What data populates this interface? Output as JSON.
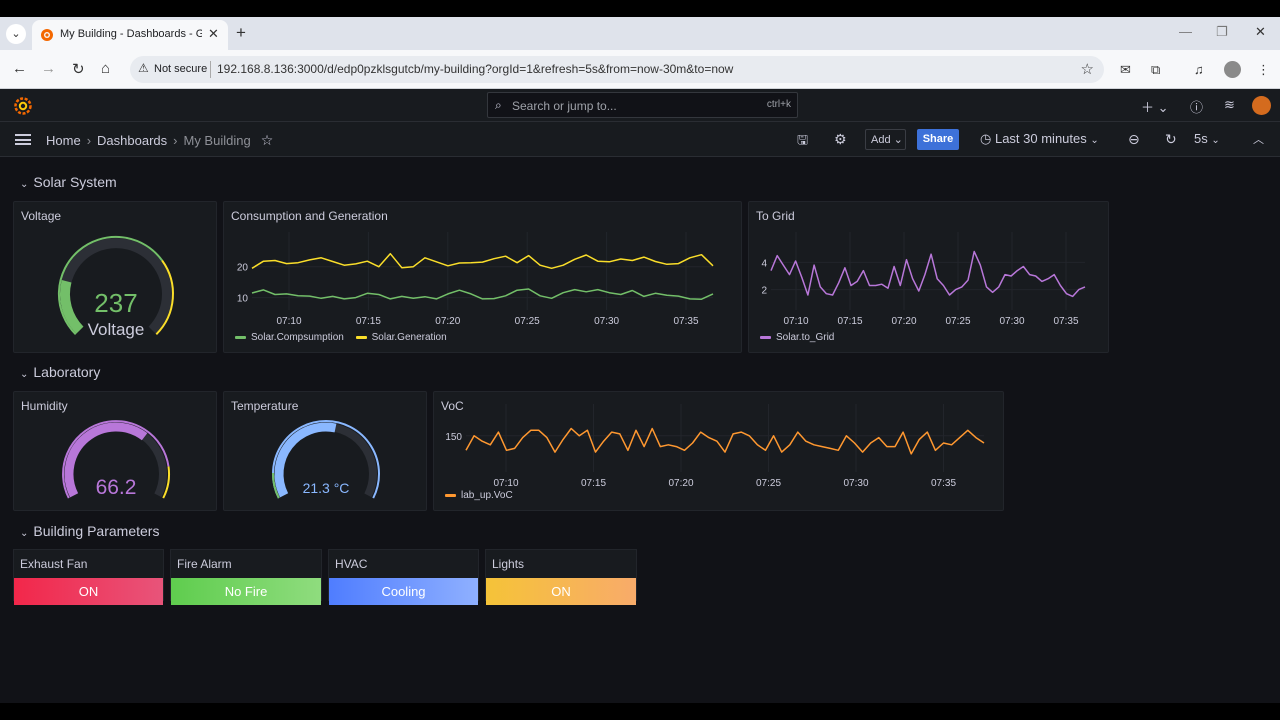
{
  "browser": {
    "tab_title": "My Building - Dashboards - Gr",
    "security_label": "Not secure",
    "url": "192.168.8.136:3000/d/edp0pzklsgutcb/my-building?orgId=1&refresh=5s&from=now-30m&to=now"
  },
  "grafana": {
    "search_placeholder": "Search or jump to...",
    "search_shortcut": "ctrl+k",
    "breadcrumb": [
      "Home",
      "Dashboards",
      "My Building"
    ],
    "toolbar": {
      "add_label": "Add",
      "share_label": "Share",
      "time_range": "Last 30 minutes",
      "refresh_interval": "5s"
    }
  },
  "rows": {
    "solar": "Solar System",
    "lab": "Laboratory",
    "building": "Building Parameters"
  },
  "panels": {
    "voltage": {
      "title": "Voltage",
      "value": "237",
      "unit_label": "Voltage",
      "fraction": 0.7,
      "color": "#73bf69"
    },
    "consumption": {
      "title": "Consumption and Generation"
    },
    "to_grid": {
      "title": "To Grid"
    },
    "humidity": {
      "title": "Humidity",
      "value": "66.2",
      "fraction": 0.66,
      "color": "#b877d9"
    },
    "temperature": {
      "title": "Temperature",
      "value": "21.3 °C",
      "fraction": 0.55,
      "color": "#8ab8ff"
    },
    "voc": {
      "title": "VoC"
    }
  },
  "chart_data": [
    {
      "type": "line",
      "panel": "Consumption and Generation",
      "x_ticks": [
        "07:10",
        "07:15",
        "07:20",
        "07:25",
        "07:30",
        "07:35"
      ],
      "y_ticks": [
        10,
        20
      ],
      "ylim": [
        6,
        28
      ],
      "series": [
        {
          "name": "Solar.Compsumption",
          "color": "#73bf69",
          "values": [
            11.5,
            12.5,
            11,
            11.2,
            10.6,
            10.5,
            9.8,
            10.4,
            9.6,
            10,
            11.4,
            11,
            9.6,
            10.4,
            9.8,
            10.3,
            9.6,
            11.2,
            12.4,
            11.2,
            9.6,
            9.7,
            10.6,
            12.4,
            12.8,
            10.6,
            9.8,
            11.6,
            12.6,
            11.9,
            12.6,
            11.6,
            11,
            12.3,
            10.4,
            11.4,
            10.8,
            10.5,
            9.6,
            9.5,
            11.2
          ]
        },
        {
          "name": "Solar.Generation",
          "color": "#fade2a",
          "values": [
            19.5,
            21.8,
            22,
            21,
            21.3,
            22.2,
            22.9,
            21.7,
            20.5,
            20.9,
            21.8,
            20,
            24.2,
            19.7,
            20,
            22.9,
            21.6,
            20.3,
            21.2,
            21.3,
            21.5,
            22.6,
            23.4,
            21.3,
            23.6,
            20.5,
            19.5,
            20.5,
            22.4,
            23.8,
            21.8,
            21.6,
            22.5,
            22,
            23.1,
            21.7,
            20.8,
            21,
            22.9,
            23.9,
            20.3
          ]
        }
      ]
    },
    {
      "type": "line",
      "panel": "To Grid",
      "x_ticks": [
        "07:10",
        "07:15",
        "07:20",
        "07:25",
        "07:30",
        "07:35"
      ],
      "y_ticks": [
        2,
        4
      ],
      "ylim": [
        0.5,
        5.5
      ],
      "series": [
        {
          "name": "Solar.to_Grid",
          "color": "#b877d9",
          "values": [
            3.4,
            4.5,
            3.8,
            3.1,
            4.1,
            2.9,
            1.6,
            3.8,
            2.2,
            1.7,
            1.6,
            2.5,
            3.6,
            2.3,
            2.6,
            3.4,
            2.3,
            2.3,
            2.4,
            2.1,
            3.7,
            2.3,
            4.2,
            2.8,
            1.9,
            3.1,
            4.6,
            2.8,
            2.3,
            1.6,
            2,
            2.2,
            2.7,
            4.8,
            3.8,
            2.2,
            1.8,
            2.2,
            3.1,
            3,
            3.4,
            3.7,
            3.1,
            3,
            2.6,
            2.8,
            3.1,
            2.3,
            1.7,
            1.5,
            2,
            2.2
          ]
        }
      ]
    },
    {
      "type": "line",
      "panel": "VoC",
      "x_ticks": [
        "07:10",
        "07:15",
        "07:20",
        "07:25",
        "07:30",
        "07:35"
      ],
      "y_ticks": [
        150
      ],
      "ylim": [
        130,
        162
      ],
      "series": [
        {
          "name": "lab_up.VoC",
          "color": "#ff9830",
          "values": [
            142,
            150,
            147,
            145,
            152,
            142,
            143,
            149,
            153,
            153,
            149,
            141,
            148,
            154,
            150,
            153,
            141,
            147,
            152,
            151,
            142,
            153,
            144,
            154,
            144,
            145,
            144,
            142,
            146,
            152,
            149,
            147,
            141,
            151,
            152,
            150,
            145,
            142,
            150,
            141,
            145,
            152,
            147,
            145,
            144,
            143,
            142,
            150,
            146,
            141,
            146,
            149,
            144,
            144,
            152,
            140,
            148,
            152,
            142,
            146,
            145,
            149,
            153,
            149,
            146
          ]
        }
      ]
    }
  ],
  "stats": [
    {
      "title": "Exhaust Fan",
      "value": "ON",
      "color": "#f2274a",
      "color2": "#e8547a"
    },
    {
      "title": "Fire Alarm",
      "value": "No Fire",
      "color": "#5fcd4e",
      "color2": "#8fdc7e"
    },
    {
      "title": "HVAC",
      "value": "Cooling",
      "color": "#4f7dff",
      "color2": "#8fb0ff"
    },
    {
      "title": "Lights",
      "value": "ON",
      "color": "#f5c338",
      "color2": "#f8ab6a"
    }
  ]
}
